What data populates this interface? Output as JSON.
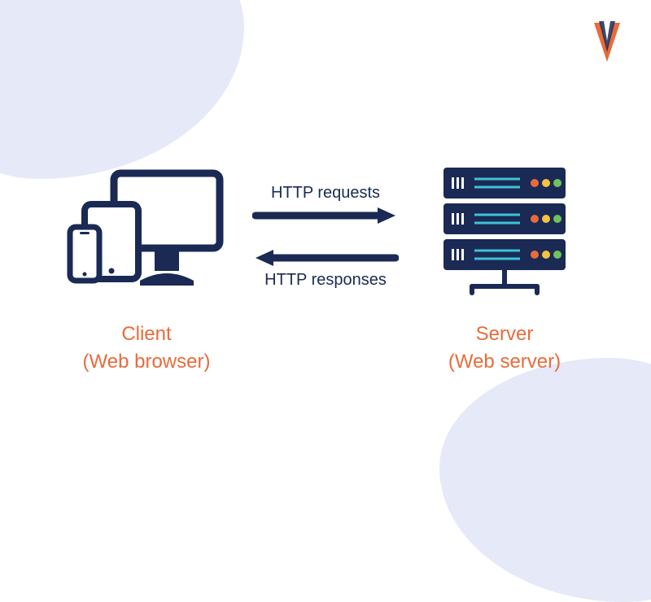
{
  "logo": {
    "name": "brand-logo"
  },
  "client": {
    "title": "Client",
    "subtitle": "(Web browser)"
  },
  "server": {
    "title": "Server",
    "subtitle": "(Web server)"
  },
  "arrows": {
    "request_label": "HTTP requests",
    "response_label": "HTTP responses"
  },
  "colors": {
    "navy": "#1a2a55",
    "orange": "#e96b3a",
    "blob": "#e6e9f7",
    "teal": "#3fc1d6"
  }
}
